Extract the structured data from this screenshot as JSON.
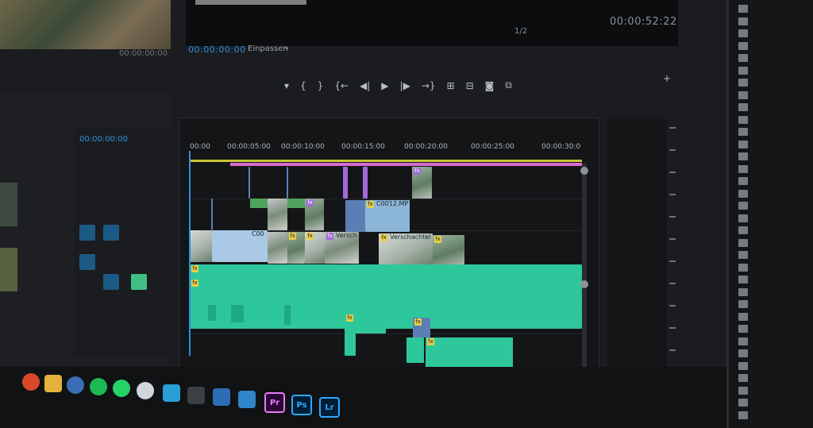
{
  "program_monitor": {
    "timecode": "00:00:00:00",
    "fit_label": "Einpassen",
    "ratio": "1/2",
    "duration": "00:00:52:22",
    "source_timecode": "00:00:00:00"
  },
  "transport_controls": [
    "marker-icon",
    "in-point-icon",
    "out-point-icon",
    "go-to-in-icon",
    "step-back-icon",
    "play-icon",
    "step-forward-icon",
    "go-to-out-icon",
    "lift-icon",
    "extract-icon",
    "export-frame-icon",
    "comparison-icon"
  ],
  "timeline": {
    "sequence_tc": "00:00:00:00",
    "ruler": [
      "00:00",
      "00:00:05:00",
      "00:00:10:00",
      "00:00:15:00",
      "00:00:20:00",
      "00:00:25:00",
      "00:00:30:0"
    ],
    "clips": {
      "c0012": "C0012.MP",
      "versch_1": "Versch",
      "versch_2": "Verschachtel",
      "c0024": "C00"
    },
    "fx": "fx"
  },
  "taskbar": {
    "apps": [
      {
        "name": "premiere",
        "label": "Pr",
        "color": "#e77bf5"
      },
      {
        "name": "photoshop",
        "label": "Ps",
        "color": "#31a8ff"
      },
      {
        "name": "lightroom",
        "label": "Lr",
        "color": "#31a8ff"
      }
    ]
  },
  "colors": {
    "accent_blue": "#2f8fe0",
    "audio_green": "#2ec79c",
    "video_green": "#4fa35c",
    "magenta": "#d86bd2",
    "yellow": "#c8c43a"
  }
}
